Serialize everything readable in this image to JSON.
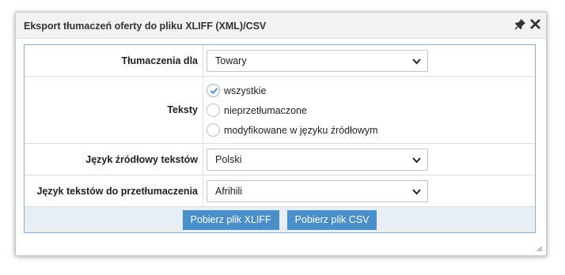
{
  "dialog": {
    "title": "Eksport tłumaczeń oferty do pliku XLIFF (XML)/CSV",
    "icons": [
      "pin-icon",
      "close-icon"
    ]
  },
  "form": {
    "translations_for": {
      "label": "Tłumaczenia dla",
      "value": "Towary"
    },
    "texts": {
      "label": "Teksty",
      "options": [
        {
          "label": "wszystkie",
          "checked": true
        },
        {
          "label": "nieprzetłumaczone",
          "checked": false
        },
        {
          "label": "modyfikowane w języku źródłowym",
          "checked": false
        }
      ]
    },
    "source_language": {
      "label": "Język źródłowy tekstów",
      "value": "Polski"
    },
    "target_language": {
      "label": "Język tekstów do przetłumaczenia",
      "value": "Afrihili"
    }
  },
  "buttons": {
    "xliff": "Pobierz plik XLIFF",
    "csv": "Pobierz plik CSV"
  },
  "colors": {
    "accent": "#4a8fc9",
    "footer_bg": "#e7eef6",
    "form_border": "#8fb3d6"
  }
}
